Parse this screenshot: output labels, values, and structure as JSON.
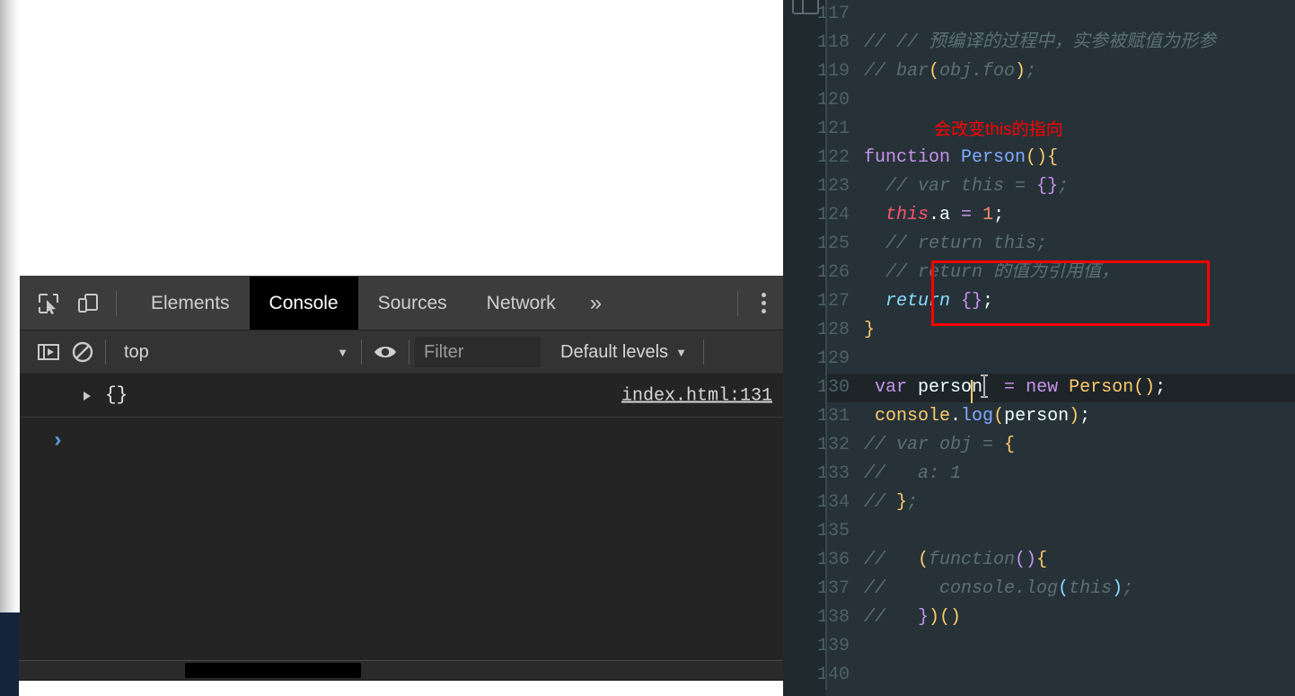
{
  "devtools": {
    "toolbar_icons": [
      {
        "name": "inspect-element-icon",
        "title": "Inspect element"
      },
      {
        "name": "device-toolbar-icon",
        "title": "Toggle device toolbar"
      }
    ],
    "tabs": [
      {
        "label": "Elements",
        "active": false
      },
      {
        "label": "Console",
        "active": true
      },
      {
        "label": "Sources",
        "active": false
      },
      {
        "label": "Network",
        "active": false
      }
    ],
    "overflow_label": "»",
    "kebab_name": "more-options-icon",
    "filterbar": {
      "sidebar_toggle_name": "console-sidebar-icon",
      "clear_console_name": "clear-console-icon",
      "context_value": "top",
      "context_caret": "▼",
      "eye_icon_name": "live-expression-eye-icon",
      "filter_placeholder": "Filter",
      "filter_value": "",
      "levels_label": "Default levels",
      "levels_caret": "▼"
    },
    "console": {
      "rows": [
        {
          "expand_icon": "disclosure-triangle-icon",
          "preview": "{}",
          "source": "index.html:131"
        }
      ],
      "prompt_caret": "›",
      "prompt_value": ""
    }
  },
  "editor": {
    "accent_red": "#ff0000",
    "background": "#263238",
    "annotation_text": "会改变this的指向",
    "current_line": 130,
    "lines": [
      {
        "n": "117",
        "tokens": []
      },
      {
        "n": "118",
        "tokens": [
          {
            "t": "// // 预编译的过程中，实参被赋值为形参",
            "c": "c-comment"
          }
        ]
      },
      {
        "n": "119",
        "tokens": [
          {
            "t": "// bar",
            "c": "c-comment"
          },
          {
            "t": "(",
            "c": "c-brace1"
          },
          {
            "t": "obj.foo",
            "c": "c-comment"
          },
          {
            "t": ")",
            "c": "c-brace1"
          },
          {
            "t": ";",
            "c": "c-comment"
          }
        ]
      },
      {
        "n": "120",
        "tokens": []
      },
      {
        "n": "121",
        "tokens": []
      },
      {
        "n": "122",
        "tokens": [
          {
            "t": "function ",
            "c": "c-kw"
          },
          {
            "t": "Person",
            "c": "c-fn"
          },
          {
            "t": "()",
            "c": "c-brace1"
          },
          {
            "t": "{",
            "c": "c-brace1"
          }
        ]
      },
      {
        "n": "123",
        "tokens": [
          {
            "t": "  // var this = ",
            "c": "c-comment"
          },
          {
            "t": "{}",
            "c": "c-brace2"
          },
          {
            "t": ";",
            "c": "c-comment"
          }
        ]
      },
      {
        "n": "124",
        "tokens": [
          {
            "t": "  ",
            "c": "c-plain"
          },
          {
            "t": "this",
            "c": "c-this"
          },
          {
            "t": ".a ",
            "c": "c-plain"
          },
          {
            "t": "= ",
            "c": "c-kw"
          },
          {
            "t": "1",
            "c": "c-num"
          },
          {
            "t": ";",
            "c": "c-plain"
          }
        ]
      },
      {
        "n": "125",
        "tokens": [
          {
            "t": "  // return this;",
            "c": "c-comment"
          }
        ]
      },
      {
        "n": "126",
        "tokens": [
          {
            "t": "  // return 的值为引用值，",
            "c": "c-comment"
          }
        ]
      },
      {
        "n": "127",
        "tokens": [
          {
            "t": "  ",
            "c": "c-plain"
          },
          {
            "t": "return ",
            "c": "c-ret"
          },
          {
            "t": "{}",
            "c": "c-brace2"
          },
          {
            "t": ";",
            "c": "c-plain"
          }
        ]
      },
      {
        "n": "128",
        "tokens": [
          {
            "t": "}",
            "c": "c-brace1"
          }
        ]
      },
      {
        "n": "129",
        "tokens": []
      },
      {
        "n": "130",
        "tokens": [
          {
            "t": " ",
            "c": "c-plain"
          },
          {
            "t": "var ",
            "c": "c-kw"
          },
          {
            "t": "person  ",
            "c": "c-plain"
          },
          {
            "t": "= ",
            "c": "c-kw"
          },
          {
            "t": "new ",
            "c": "c-kw"
          },
          {
            "t": "Person",
            "c": "c-cls"
          },
          {
            "t": "()",
            "c": "c-brace1"
          },
          {
            "t": ";",
            "c": "c-plain"
          }
        ]
      },
      {
        "n": "131",
        "tokens": [
          {
            "t": " ",
            "c": "c-plain"
          },
          {
            "t": "console",
            "c": "c-prop"
          },
          {
            "t": ".",
            "c": "c-plain"
          },
          {
            "t": "log",
            "c": "c-fn"
          },
          {
            "t": "(",
            "c": "c-brace1"
          },
          {
            "t": "person",
            "c": "c-plain"
          },
          {
            "t": ")",
            "c": "c-brace1"
          },
          {
            "t": ";",
            "c": "c-plain"
          }
        ]
      },
      {
        "n": "132",
        "tokens": [
          {
            "t": "// var obj = ",
            "c": "c-comment"
          },
          {
            "t": "{",
            "c": "c-brace1"
          }
        ]
      },
      {
        "n": "133",
        "tokens": [
          {
            "t": "//   a: 1",
            "c": "c-comment"
          }
        ]
      },
      {
        "n": "134",
        "tokens": [
          {
            "t": "// ",
            "c": "c-comment"
          },
          {
            "t": "}",
            "c": "c-brace1"
          },
          {
            "t": ";",
            "c": "c-comment"
          }
        ]
      },
      {
        "n": "135",
        "tokens": []
      },
      {
        "n": "136",
        "tokens": [
          {
            "t": "//   ",
            "c": "c-comment"
          },
          {
            "t": "(",
            "c": "c-brace1"
          },
          {
            "t": "function",
            "c": "c-comment"
          },
          {
            "t": "()",
            "c": "c-brace2"
          },
          {
            "t": "{",
            "c": "c-brace1"
          }
        ]
      },
      {
        "n": "137",
        "tokens": [
          {
            "t": "//     console.log",
            "c": "c-comment"
          },
          {
            "t": "(",
            "c": "c-punct"
          },
          {
            "t": "this",
            "c": "c-comment"
          },
          {
            "t": ")",
            "c": "c-punct"
          },
          {
            "t": ";",
            "c": "c-comment"
          }
        ]
      },
      {
        "n": "138",
        "tokens": [
          {
            "t": "//   ",
            "c": "c-comment"
          },
          {
            "t": "}",
            "c": "c-brace2"
          },
          {
            "t": ")",
            "c": "c-brace1"
          },
          {
            "t": "()",
            "c": "c-brace1"
          }
        ]
      },
      {
        "n": "139",
        "tokens": []
      },
      {
        "n": "140",
        "tokens": []
      }
    ]
  }
}
